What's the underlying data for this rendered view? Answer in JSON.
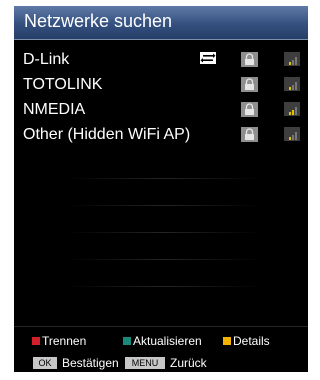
{
  "window": {
    "title": "Netzwerke suchen"
  },
  "networks": [
    {
      "name": "D-Link",
      "connected": true,
      "secured": true,
      "signal": "weak"
    },
    {
      "name": "TOTOLINK",
      "connected": false,
      "secured": true,
      "signal": "weak"
    },
    {
      "name": "NMEDIA",
      "connected": false,
      "secured": true,
      "signal": "medium"
    },
    {
      "name": "Other (Hidden WiFi AP)",
      "connected": false,
      "secured": true,
      "signal": "weak"
    }
  ],
  "footer": {
    "red_label": "Trennen",
    "green_label": "Aktualisieren",
    "yellow_label": "Details",
    "ok_key": "OK",
    "ok_label": "Bestätigen",
    "menu_key": "MENU",
    "menu_label": "Zurück"
  },
  "colors": {
    "title_bar": "#3b5686",
    "red_key": "#d2202a",
    "green_key": "#1a8a7a",
    "yellow_key": "#f2b400"
  },
  "icons": {
    "connected": "transfer-arrows-icon",
    "secured": "lock-icon",
    "signal": "signal-strength-icon"
  }
}
